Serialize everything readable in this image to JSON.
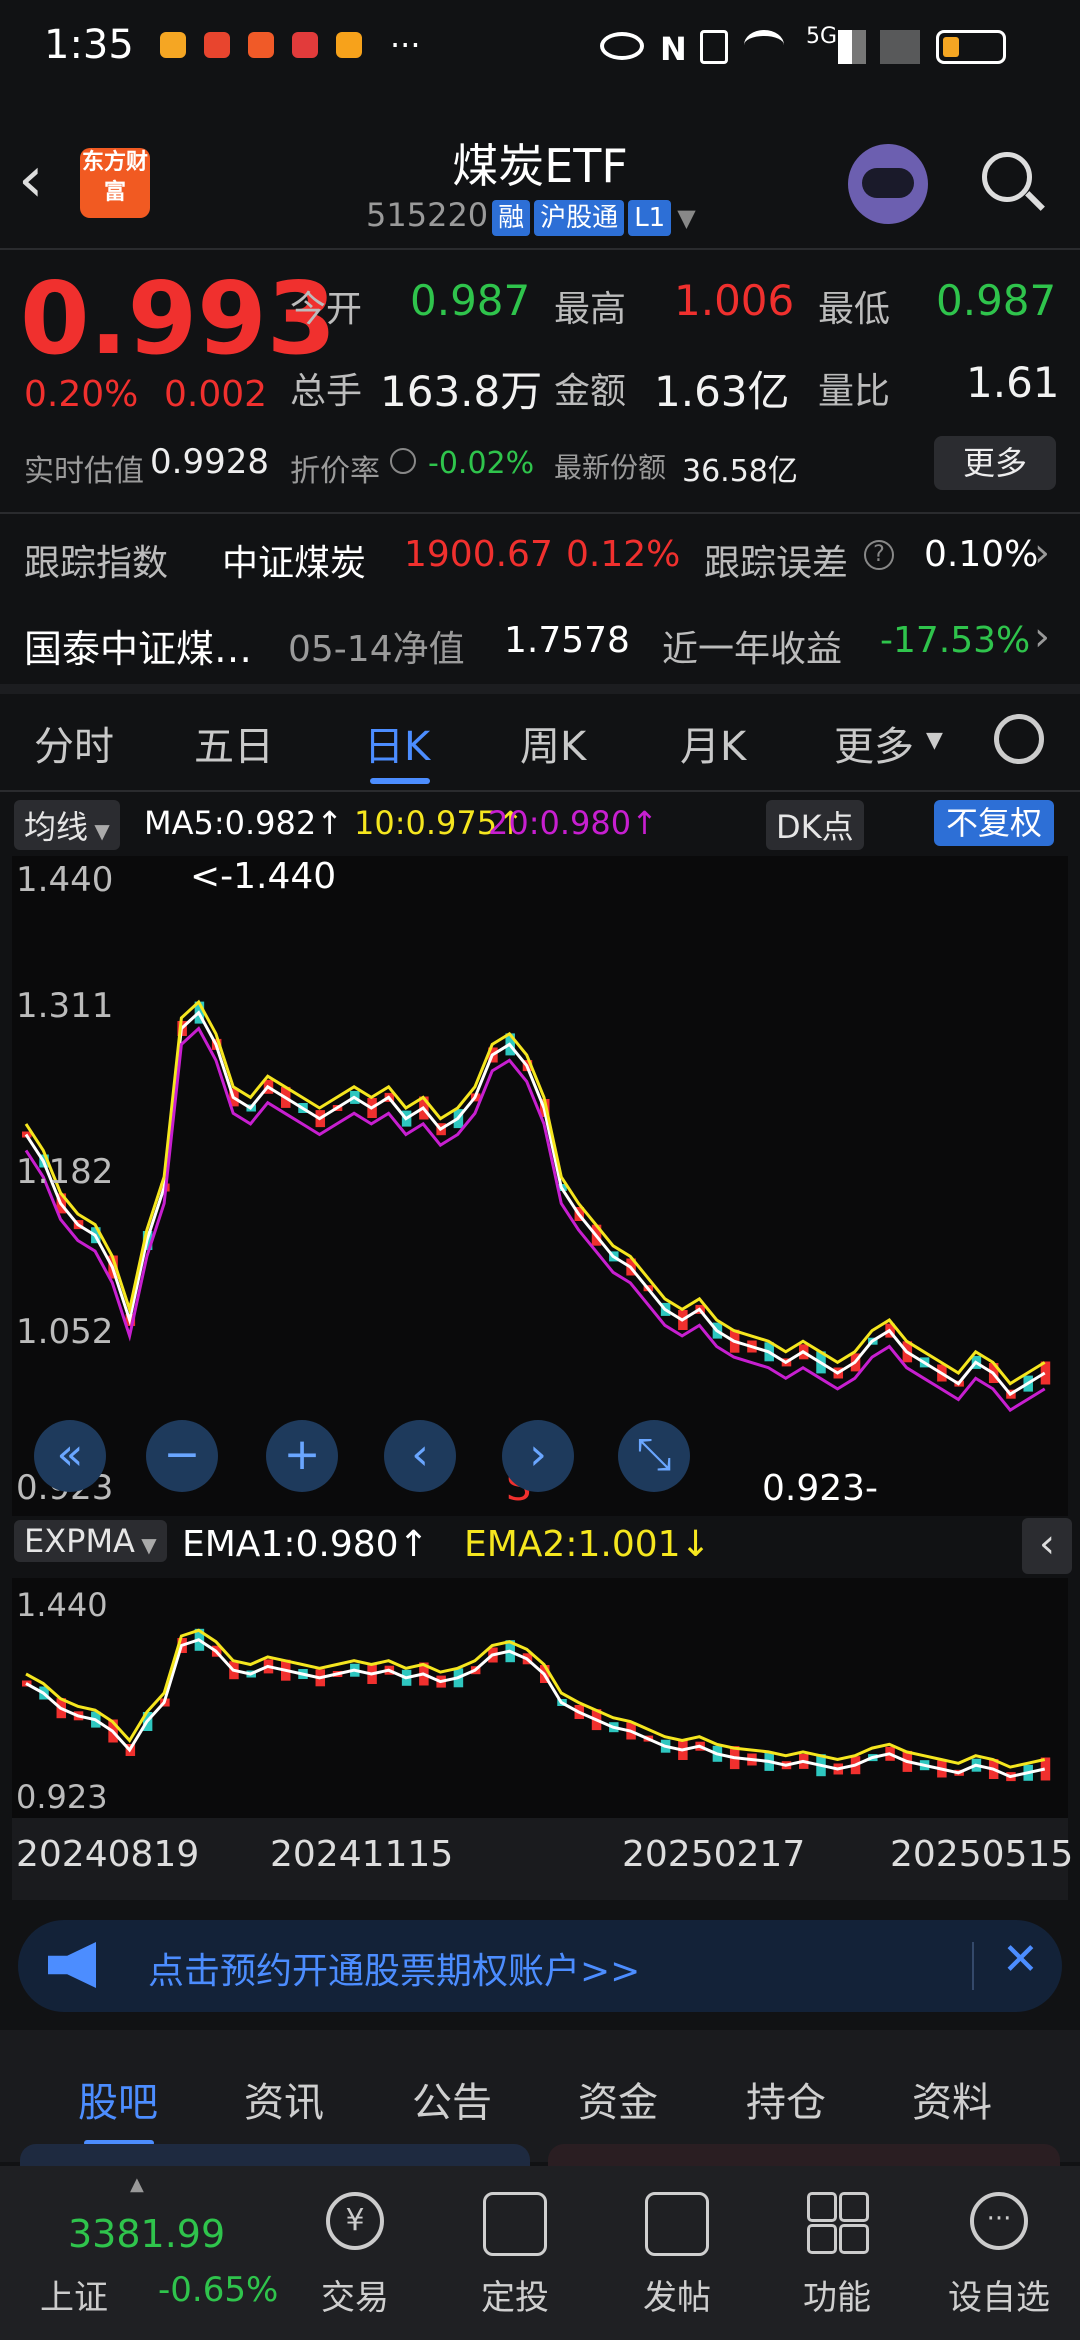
{
  "status": {
    "time": "1:35",
    "dots": "···",
    "net": "5G"
  },
  "header": {
    "logo": "东方财富",
    "title": "煤炭ETF",
    "code": "515220",
    "tags": [
      "融",
      "沪股通",
      "L1"
    ]
  },
  "quote": {
    "price": "0.993",
    "change_pct": "0.20%",
    "change": "0.002",
    "open_label": "今开",
    "open": "0.987",
    "high_label": "最高",
    "high": "1.006",
    "low_label": "最低",
    "low": "0.987",
    "vol_label": "总手",
    "vol": "163.8万",
    "amt_label": "金额",
    "amt": "1.63亿",
    "ratio_label": "量比",
    "ratio": "1.61",
    "iopv_label": "实时估值",
    "iopv": "0.9928",
    "discount_label": "折价率",
    "discount": "-0.02%",
    "shares_label": "最新份额",
    "shares": "36.58亿",
    "more": "更多"
  },
  "tracking": {
    "label": "跟踪指数",
    "index": "中证煤炭",
    "index_val": "1900.67",
    "index_pct": "0.12%",
    "err_label": "跟踪误差",
    "err": "0.10%"
  },
  "fund": {
    "name": "国泰中证煤…",
    "nav_label": "05-14净值",
    "nav": "1.7578",
    "yr_label": "近一年收益",
    "yr": "-17.53%"
  },
  "tabs": [
    "分时",
    "五日",
    "日K",
    "周K",
    "月K",
    "更多"
  ],
  "active_tab": 2,
  "ma": {
    "label": "均线",
    "ma5": "MA5:0.982↑",
    "ma10": "10:0.975↑",
    "ma20": "20:0.980↑",
    "dk": "DK点",
    "adj": "不复权"
  },
  "main_chart": {
    "y_max": "1.440",
    "y_2": "1.311",
    "y_3": "1.182",
    "y_4": "1.052",
    "y_min": "0.923",
    "max_note": "<-1.440",
    "min_note": "0.923-",
    "s_mark": "S"
  },
  "ema": {
    "label": "EXPMA",
    "ema1": "EMA1:0.980↑",
    "ema2": "EMA2:1.001↓"
  },
  "sub_chart": {
    "y_max": "1.440",
    "y_min": "0.923"
  },
  "dates": [
    "20240819",
    "20241115",
    "20250217",
    "20250515"
  ],
  "banner": "点击预约开通股票期权账户>>",
  "bottom_tabs": [
    "股吧",
    "资讯",
    "公告",
    "资金",
    "持仓",
    "资料"
  ],
  "index_bar": {
    "name": "上证",
    "value": "3381.99",
    "pct": "-0.65%"
  },
  "nav": [
    "交易",
    "定投",
    "发帖",
    "功能",
    "设自选"
  ],
  "colors": {
    "up": "#f0302e",
    "down": "#2fc44c",
    "accent": "#4c8dff",
    "ma10": "#f5e61f",
    "ma20": "#c71fd0"
  }
}
